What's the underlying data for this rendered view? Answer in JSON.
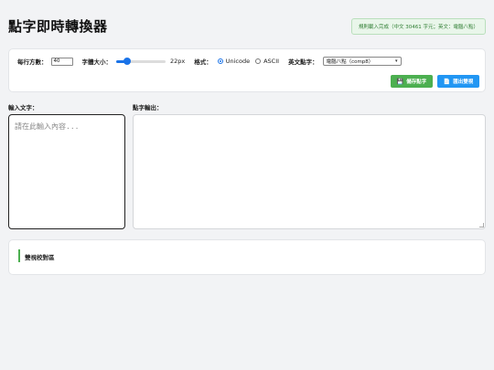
{
  "app": {
    "title": "點字即時轉換器",
    "status": "規則載入完成（中文 30461 字元；英文：電腦八點）"
  },
  "controls": {
    "per_line_label": "每行方數：",
    "per_line_value": "40",
    "font_size_label": "字體大小：",
    "font_size_value": "22px",
    "font_size_slider_fraction": 0.18,
    "format_label": "格式：",
    "format_options": [
      {
        "label": "Unicode",
        "checked": true
      },
      {
        "label": "ASCII",
        "checked": false
      }
    ],
    "english_braille_label": "英文點字：",
    "english_braille_selected": "電腦八點（comp8）",
    "save_label": "儲存點字",
    "export_label": "匯出雙視"
  },
  "input": {
    "label": "輸入文字：",
    "placeholder": "請在此輸入內容..."
  },
  "output": {
    "label": "點字輸出："
  },
  "proof": {
    "title": "雙視校對區"
  },
  "colors": {
    "accent_blue": "#1a73e8",
    "save_green": "#4caf50",
    "export_blue": "#2196f3",
    "status_green": "#2e7d32"
  },
  "icons": {
    "save": "save-icon",
    "export": "document-icon"
  }
}
